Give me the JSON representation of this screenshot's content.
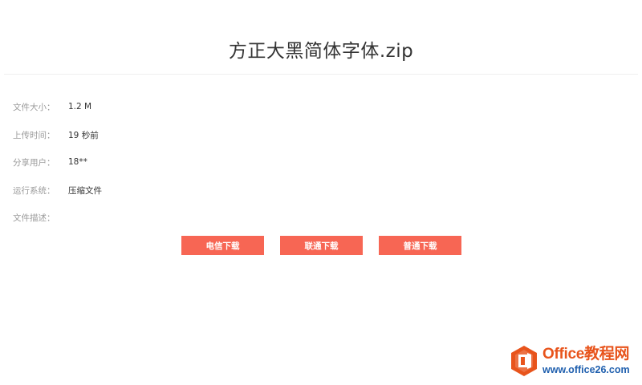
{
  "file": {
    "title": "方正大黑简体字体.zip"
  },
  "info": [
    {
      "label": "文件大小：",
      "value": "1.2 M"
    },
    {
      "label": "上传时间：",
      "value": "19 秒前"
    },
    {
      "label": "分享用户：",
      "value": "18**"
    },
    {
      "label": "运行系统：",
      "value": "压缩文件"
    },
    {
      "label": "文件描述：",
      "value": ""
    }
  ],
  "downloads": {
    "telecom": "电信下载",
    "unicom": "联通下载",
    "normal": "普通下载"
  },
  "watermark": {
    "brand": "Office教程网",
    "url": "www.office26.com",
    "icon": "office-logo-icon"
  },
  "colors": {
    "button": "#f76654",
    "brand_orange": "#e8541c",
    "brand_blue": "#1f5fae"
  }
}
